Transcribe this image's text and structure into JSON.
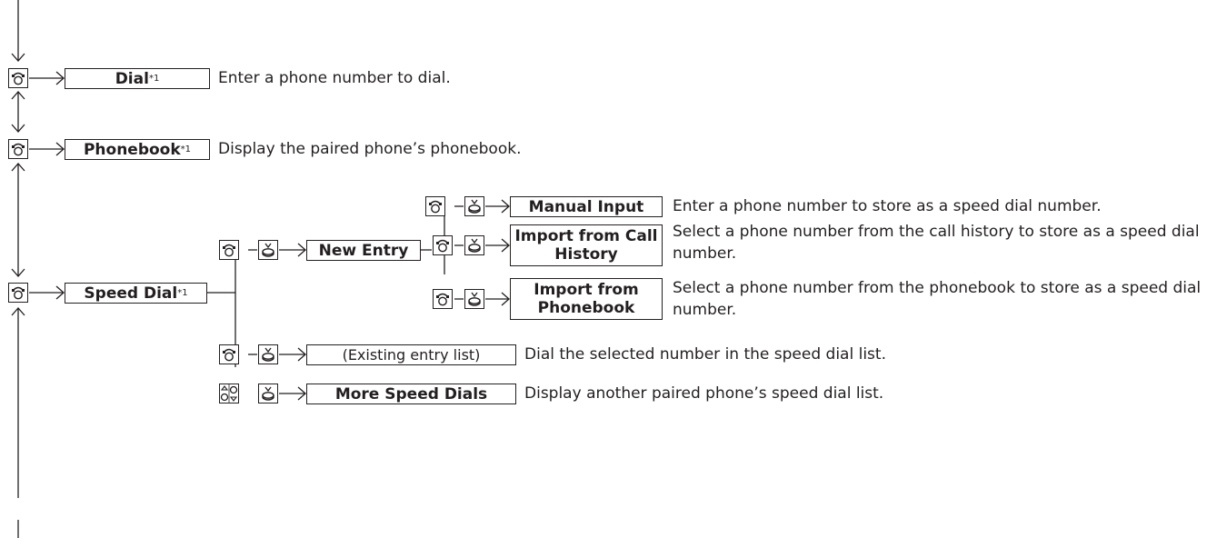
{
  "menu": {
    "dial": {
      "label": "Dial",
      "note": "*1",
      "desc": "Enter a phone number to dial."
    },
    "phonebook": {
      "label": "Phonebook",
      "note": "*1",
      "desc": "Display the paired phone’s phonebook."
    },
    "speed_dial": {
      "label": "Speed Dial",
      "note": "*1",
      "new_entry": {
        "label": "New Entry",
        "manual_input": {
          "label": "Manual Input",
          "desc": "Enter a phone number to store as a speed dial number."
        },
        "import_call_history": {
          "label": "Import from Call History",
          "desc": "Select a phone number from the call history to store as a speed dial number."
        },
        "import_phonebook": {
          "label": "Import from Phonebook",
          "desc": "Select a phone number from the phonebook to store as a speed dial number."
        }
      },
      "existing": {
        "label": "(Existing entry list)",
        "desc": "Dial the selected number in the speed dial list."
      },
      "more": {
        "label": "More Speed Dials",
        "desc": "Display another paired phone’s speed dial list."
      }
    }
  },
  "icons": {
    "phone": "phone-knob-icon",
    "enter": "press-enter-icon",
    "rotate": "rotate-knob-icon"
  },
  "colors": {
    "line": "#231f20",
    "background": "#ffffff"
  }
}
